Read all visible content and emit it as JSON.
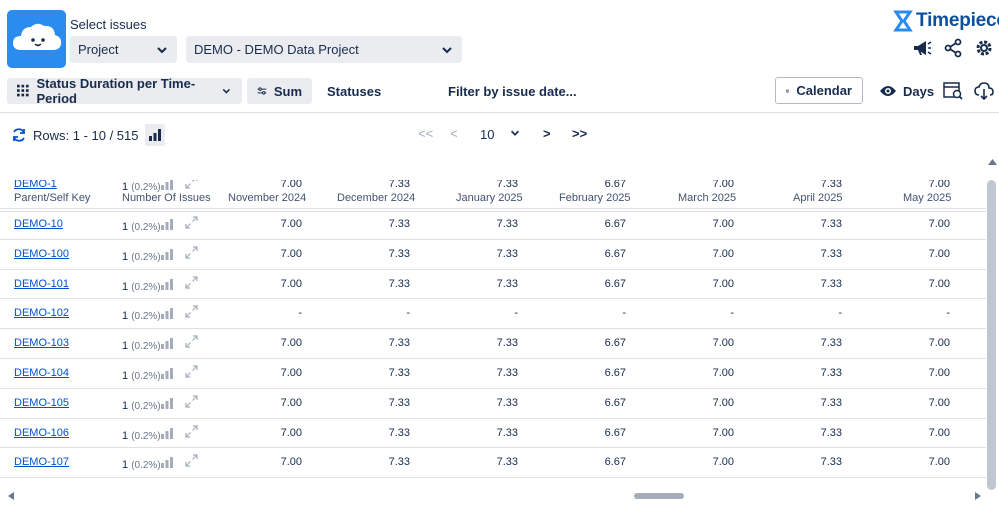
{
  "header": {
    "select_label": "Select issues",
    "scope_select": "Project",
    "project_select": "DEMO - DEMO Data Project",
    "brand": "Timepiece"
  },
  "toolbar": {
    "report_type": "Status Duration per Time-Period",
    "aggregation": "Sum",
    "statuses": "Statuses",
    "filter": "Filter by issue date...",
    "calendar": "Calendar",
    "unit": "Days"
  },
  "pagination": {
    "rows_label": "Rows: 1 - 10 / 515",
    "first": "<<",
    "prev": "<",
    "page_size": "10",
    "next": ">",
    "last": ">>"
  },
  "table": {
    "columns": [
      "Parent/Self Key",
      "Number Of Issues",
      "November 2024",
      "December 2024",
      "January 2025",
      "February 2025",
      "March 2025",
      "April 2025",
      "May 2025"
    ],
    "rows": [
      {
        "key": "DEMO-1",
        "count": "1",
        "pct": "(0.2%)",
        "values": [
          "7.00",
          "7.33",
          "7.33",
          "6.67",
          "7.00",
          "7.33",
          "7.00"
        ]
      },
      {
        "key": "DEMO-10",
        "count": "1",
        "pct": "(0.2%)",
        "values": [
          "7.00",
          "7.33",
          "7.33",
          "6.67",
          "7.00",
          "7.33",
          "7.00"
        ]
      },
      {
        "key": "DEMO-100",
        "count": "1",
        "pct": "(0.2%)",
        "values": [
          "7.00",
          "7.33",
          "7.33",
          "6.67",
          "7.00",
          "7.33",
          "7.00"
        ]
      },
      {
        "key": "DEMO-101",
        "count": "1",
        "pct": "(0.2%)",
        "values": [
          "7.00",
          "7.33",
          "7.33",
          "6.67",
          "7.00",
          "7.33",
          "7.00"
        ]
      },
      {
        "key": "DEMO-102",
        "count": "1",
        "pct": "(0.2%)",
        "values": [
          "-",
          "-",
          "-",
          "-",
          "-",
          "-",
          "-"
        ]
      },
      {
        "key": "DEMO-103",
        "count": "1",
        "pct": "(0.2%)",
        "values": [
          "7.00",
          "7.33",
          "7.33",
          "6.67",
          "7.00",
          "7.33",
          "7.00"
        ]
      },
      {
        "key": "DEMO-104",
        "count": "1",
        "pct": "(0.2%)",
        "values": [
          "7.00",
          "7.33",
          "7.33",
          "6.67",
          "7.00",
          "7.33",
          "7.00"
        ]
      },
      {
        "key": "DEMO-105",
        "count": "1",
        "pct": "(0.2%)",
        "values": [
          "7.00",
          "7.33",
          "7.33",
          "6.67",
          "7.00",
          "7.33",
          "7.00"
        ]
      },
      {
        "key": "DEMO-106",
        "count": "1",
        "pct": "(0.2%)",
        "values": [
          "7.00",
          "7.33",
          "7.33",
          "6.67",
          "7.00",
          "7.33",
          "7.00"
        ]
      },
      {
        "key": "DEMO-107",
        "count": "1",
        "pct": "(0.2%)",
        "values": [
          "7.00",
          "7.33",
          "7.33",
          "6.67",
          "7.00",
          "7.33",
          "7.00"
        ]
      }
    ]
  },
  "colors": {
    "accent": "#2b8cef",
    "brand": "#0d4f9c",
    "link": "#0052cc"
  }
}
